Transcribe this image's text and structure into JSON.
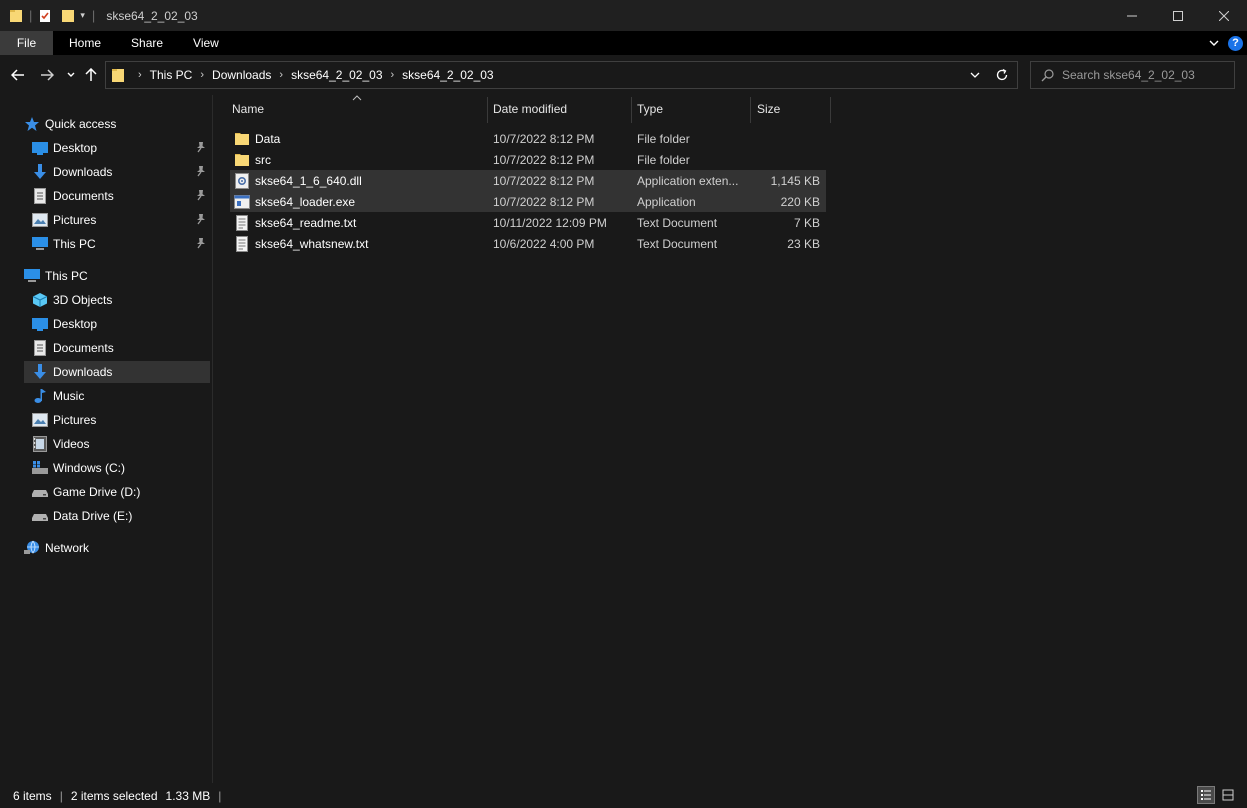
{
  "window": {
    "title": "skse64_2_02_03",
    "controls": [
      "minimize-icon",
      "maximize-icon",
      "close-icon"
    ]
  },
  "ribbon": {
    "tabs": [
      "File",
      "Home",
      "Share",
      "View"
    ]
  },
  "address": {
    "crumbs": [
      "This PC",
      "Downloads",
      "skse64_2_02_03",
      "skse64_2_02_03"
    ]
  },
  "search": {
    "placeholder": "Search skse64_2_02_03"
  },
  "sidebar": {
    "quick_access": {
      "label": "Quick access",
      "items": [
        {
          "label": "Desktop",
          "icon": "desktop-icon",
          "pinned": true
        },
        {
          "label": "Downloads",
          "icon": "downloads-icon",
          "pinned": true
        },
        {
          "label": "Documents",
          "icon": "documents-icon",
          "pinned": true
        },
        {
          "label": "Pictures",
          "icon": "pictures-icon",
          "pinned": true
        },
        {
          "label": "This PC",
          "icon": "this-pc-icon",
          "pinned": true
        }
      ]
    },
    "this_pc": {
      "label": "This PC",
      "items": [
        {
          "label": "3D Objects",
          "icon": "3d-objects-icon"
        },
        {
          "label": "Desktop",
          "icon": "desktop-icon"
        },
        {
          "label": "Documents",
          "icon": "documents-icon"
        },
        {
          "label": "Downloads",
          "icon": "downloads-icon",
          "selected": true
        },
        {
          "label": "Music",
          "icon": "music-icon"
        },
        {
          "label": "Pictures",
          "icon": "pictures-icon"
        },
        {
          "label": "Videos",
          "icon": "videos-icon"
        },
        {
          "label": "Windows (C:)",
          "icon": "windows-drive-icon"
        },
        {
          "label": "Game Drive (D:)",
          "icon": "drive-icon"
        },
        {
          "label": "Data Drive (E:)",
          "icon": "drive-icon"
        }
      ]
    },
    "network": {
      "label": "Network",
      "icon": "network-icon"
    }
  },
  "columns": [
    "Name",
    "Date modified",
    "Type",
    "Size"
  ],
  "files": [
    {
      "name": "Data",
      "date": "10/7/2022 8:12 PM",
      "type": "File folder",
      "size": "",
      "icon": "folder-icon",
      "selected": false
    },
    {
      "name": "src",
      "date": "10/7/2022 8:12 PM",
      "type": "File folder",
      "size": "",
      "icon": "folder-icon",
      "selected": false
    },
    {
      "name": "skse64_1_6_640.dll",
      "date": "10/7/2022 8:12 PM",
      "type": "Application exten...",
      "size": "1,145 KB",
      "icon": "dll-file-icon",
      "selected": true
    },
    {
      "name": "skse64_loader.exe",
      "date": "10/7/2022 8:12 PM",
      "type": "Application",
      "size": "220 KB",
      "icon": "exe-file-icon",
      "selected": true
    },
    {
      "name": "skse64_readme.txt",
      "date": "10/11/2022 12:09 PM",
      "type": "Text Document",
      "size": "7 KB",
      "icon": "text-file-icon",
      "selected": false
    },
    {
      "name": "skse64_whatsnew.txt",
      "date": "10/6/2022 4:00 PM",
      "type": "Text Document",
      "size": "23 KB",
      "icon": "text-file-icon",
      "selected": false
    }
  ],
  "status": {
    "items": "6 items",
    "selected": "2 items selected",
    "size": "1.33 MB"
  },
  "colors": {
    "folder": "#f8d775",
    "accent": "#1a73e8",
    "selection": "#333333"
  }
}
